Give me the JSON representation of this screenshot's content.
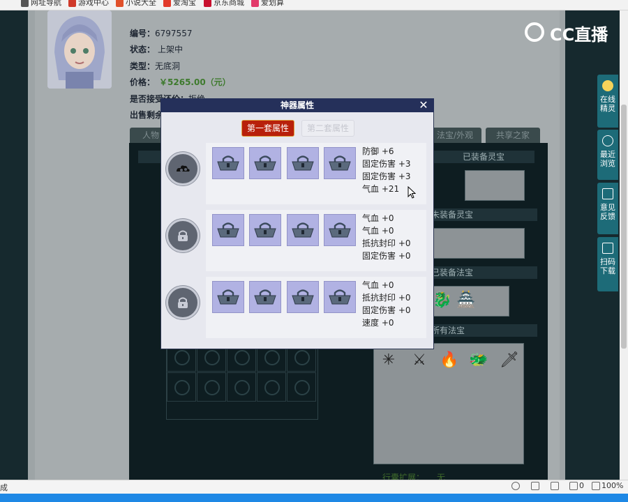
{
  "bookmarks": [
    {
      "label": "网址导航",
      "color": "#555555"
    },
    {
      "label": "游戏中心",
      "color": "#d03a2a"
    },
    {
      "label": "小说大全",
      "color": "#e0502a"
    },
    {
      "label": "爱淘宝",
      "color": "#e23a2a"
    },
    {
      "label": "京东商城",
      "color": "#c8102e"
    },
    {
      "label": "爱划算",
      "color": "#e23a6a"
    }
  ],
  "listing": {
    "id_label": "编号：",
    "id_value": "6797557",
    "status_label": "状态：",
    "status_value": "上架中",
    "type_label": "类型：",
    "type_value": "无底洞",
    "price_label": "价格：",
    "price_value": "￥5265.00（元）",
    "bargain_label": "是否接受还价：",
    "bargain_value": "拒绝",
    "remain_label": "出售剩余"
  },
  "game_tabs": [
    "人物",
    "法宝/外观",
    "共享之家"
  ],
  "sections": {
    "equipped_lingbao": "已装备灵宝",
    "unequipped_lingbao": "未装备灵宝",
    "equipped_fabao": "已装备法宝",
    "all_fabao": "所有法宝",
    "ext_label": "行囊扩展：",
    "ext_value": "无"
  },
  "logo": {
    "text": "CC直播"
  },
  "sidebar": [
    {
      "label": "在线\n精灵",
      "icon": "sprite-icon"
    },
    {
      "label": "最近\n浏览",
      "icon": "clock-icon"
    },
    {
      "label": "意见\n反馈",
      "icon": "edit-icon"
    },
    {
      "label": "扫码\n下载",
      "icon": "scan-icon"
    }
  ],
  "modal": {
    "title": "神器属性",
    "close": "✕",
    "tabs": [
      {
        "label": "第一套属性",
        "active": true
      },
      {
        "label": "第二套属性",
        "active": false
      }
    ],
    "sets": [
      {
        "attrs": [
          "防御 +6",
          "固定伤害 +3",
          "固定伤害 +3",
          "气血 +21"
        ],
        "core_icon": "cloud-swirl-icon"
      },
      {
        "attrs": [
          "气血 +0",
          "气血 +0",
          "抵抗封印 +0",
          "固定伤害 +0"
        ],
        "core_icon": "lock-icon"
      },
      {
        "attrs": [
          "气血 +0",
          "抵抗封印 +0",
          "固定伤害 +0",
          "速度 +0"
        ],
        "core_icon": "lock-icon"
      }
    ]
  },
  "statusbar": {
    "left": "成",
    "count": "0",
    "zoom": "100%"
  },
  "colors": {
    "modal_header": "#25305a",
    "active_tab": "#b8200b",
    "slot_bg": "#b1b2e3",
    "page_dim": "#16292e",
    "sidebar": "#1d6b78"
  }
}
